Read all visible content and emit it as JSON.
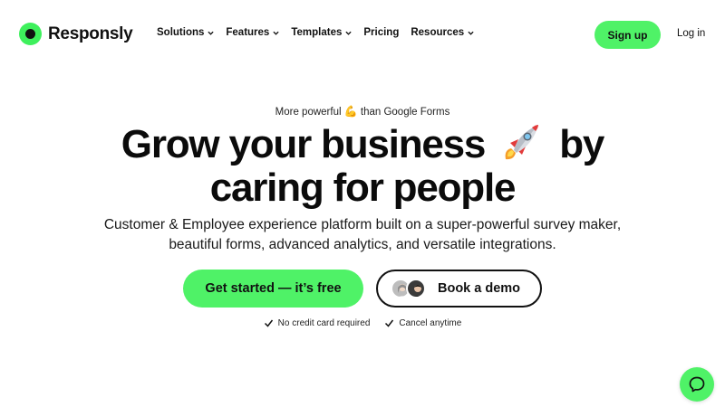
{
  "brand": {
    "name": "Responsly",
    "accent": "#4ff267",
    "dark": "#111111"
  },
  "nav": {
    "items": [
      {
        "label": "Solutions",
        "has_dropdown": true
      },
      {
        "label": "Features",
        "has_dropdown": true
      },
      {
        "label": "Templates",
        "has_dropdown": true
      },
      {
        "label": "Pricing",
        "has_dropdown": false
      },
      {
        "label": "Resources",
        "has_dropdown": true
      }
    ],
    "signup_label": "Sign up",
    "login_label": "Log in"
  },
  "hero": {
    "eyebrow_before": "More powerful",
    "eyebrow_emoji": "💪",
    "eyebrow_after": "than Google Forms",
    "headline_part1": "Grow your business",
    "headline_part2": "by",
    "headline_line2": "caring for people",
    "headline_icon": "rocket-icon",
    "subtext": "Customer & Employee experience platform built on a super-powerful survey maker, beautiful forms, advanced analytics, and versatile integrations.",
    "cta_primary": "Get started — it’s free",
    "cta_demo": "Book a demo",
    "checks": [
      "No credit card required",
      "Cancel anytime"
    ]
  },
  "help_icon": "chat-bubble-icon"
}
